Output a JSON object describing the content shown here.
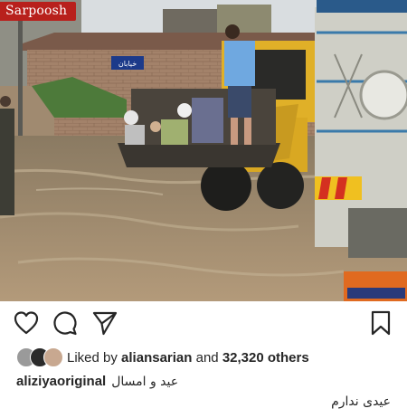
{
  "photo": {
    "watermark": "Sarpoosh",
    "sign_text": "خیابان"
  },
  "actions": {
    "like": "heart-icon",
    "comment": "comment-icon",
    "share": "send-icon",
    "save": "bookmark-icon"
  },
  "likes": {
    "prefix": "Liked by",
    "user": "aliansarian",
    "middle": "and",
    "count": "32,320 others"
  },
  "caption": {
    "username": "aliziyaoriginal",
    "text": "عید و امسال",
    "second_line": "عیدی ندارم"
  }
}
